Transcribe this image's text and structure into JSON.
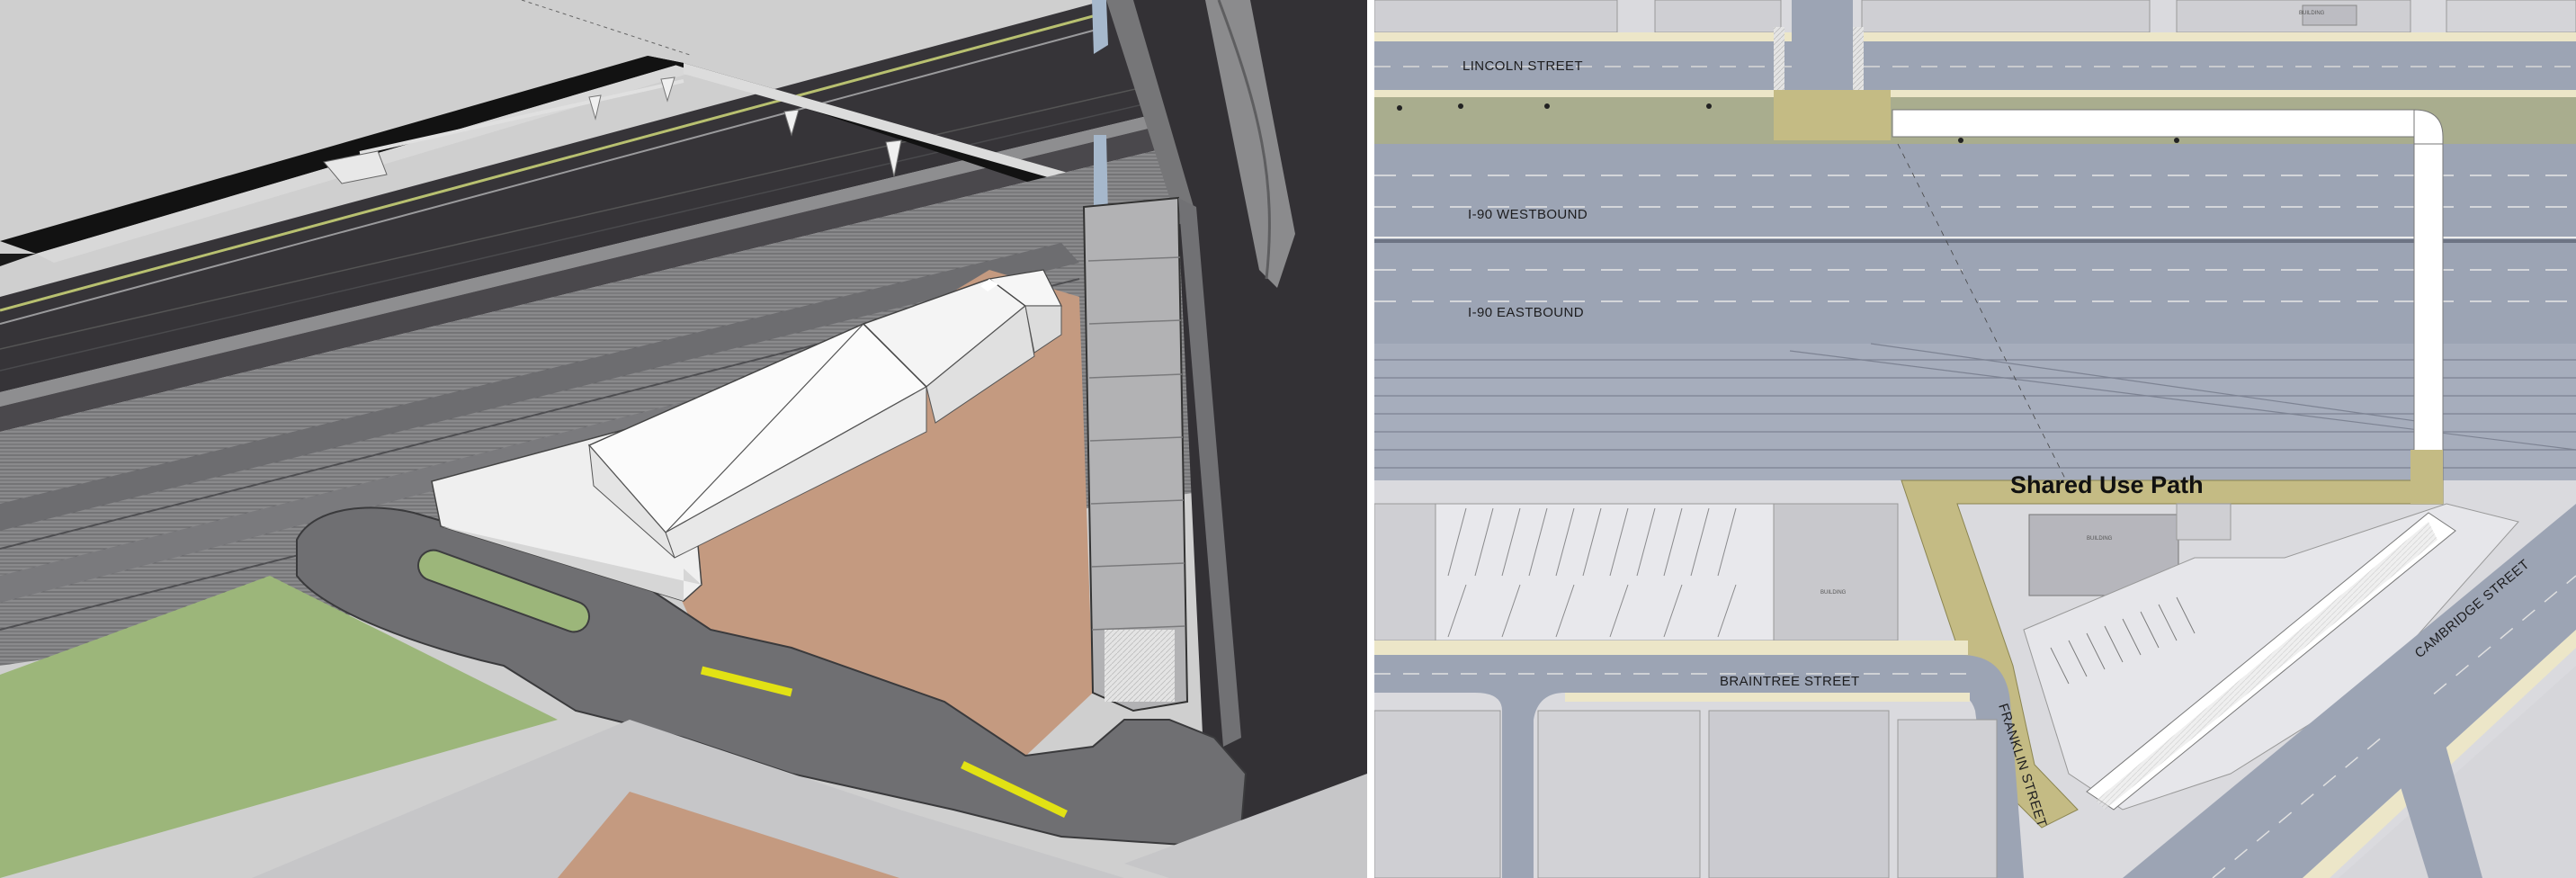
{
  "labels": {
    "lincoln_street": "LINCOLN STREET",
    "i90_westbound": "I-90 WESTBOUND",
    "i90_eastbound": "I-90 EASTBOUND",
    "braintree_street": "BRAINTREE STREET",
    "franklin_street": "FRANKLIN STREET",
    "cambridge_street": "CAMBRIDGE STREET",
    "shared_use_path": "Shared Use Path",
    "building": "BUILDING"
  },
  "colors": {
    "rendering_sky": "#cfcfcf",
    "grass_green": "#9cb67a",
    "dirt_tan": "#c49a80",
    "asphalt_dark": "#333135",
    "road_gray": "#7a7a7d",
    "highlight_yellow": "#e2e214",
    "plan_path_olive": "#c4bb84",
    "plan_road_blue": "#9ca4b4",
    "plan_sidewalk_cream": "#ece6c8"
  }
}
